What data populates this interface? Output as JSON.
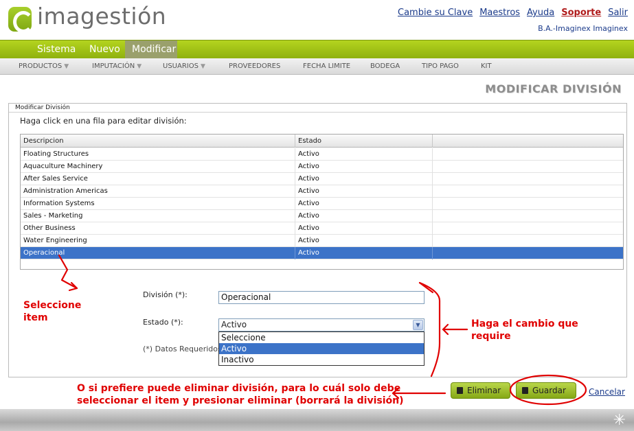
{
  "header": {
    "logo_text": "imagestión",
    "links": [
      "Cambie su Clave",
      "Maestros",
      "Ayuda",
      "Soporte",
      "Salir"
    ],
    "company": "B.A.-Imaginex Imaginex"
  },
  "main_menu": {
    "items": [
      "Sistema",
      "Nuevo",
      "Modificar"
    ],
    "active": "Modificar"
  },
  "sub_menu": {
    "items": [
      {
        "label": "PRODUCTOS",
        "arrow": "▼"
      },
      {
        "label": "IMPUTACIÓN",
        "arrow": "▼"
      },
      {
        "label": "USUARIOS",
        "arrow": "▼"
      },
      {
        "label": "PROVEEDORES",
        "arrow": ""
      },
      {
        "label": "FECHA LIMITE",
        "arrow": ""
      },
      {
        "label": "BODEGA",
        "arrow": ""
      },
      {
        "label": "TIPO PAGO",
        "arrow": ""
      },
      {
        "label": "KIT",
        "arrow": ""
      }
    ]
  },
  "page_title": "MODIFICAR DIVISIÓN",
  "panel": {
    "title": "Modificar División",
    "instruction": "Haga click en una fila para editar división:",
    "columns": [
      "Descripcion",
      "Estado"
    ],
    "rows": [
      {
        "descripcion": "Floating Structures",
        "estado": "Activo"
      },
      {
        "descripcion": "Aquaculture Machinery",
        "estado": "Activo"
      },
      {
        "descripcion": "After Sales Service",
        "estado": "Activo"
      },
      {
        "descripcion": "Administration Americas",
        "estado": "Activo"
      },
      {
        "descripcion": "Information Systems",
        "estado": "Activo"
      },
      {
        "descripcion": "Sales - Marketing",
        "estado": "Activo"
      },
      {
        "descripcion": "Other Business",
        "estado": "Activo"
      },
      {
        "descripcion": "Water Engineering",
        "estado": "Activo"
      },
      {
        "descripcion": "Operacional",
        "estado": "Activo"
      }
    ],
    "selected_row": 8
  },
  "form": {
    "division_label": "División (*):",
    "division_value": "Operacional",
    "estado_label": "Estado (*):",
    "estado_value": "Activo",
    "estado_options": [
      "Seleccione",
      "Activo",
      "Inactivo"
    ],
    "estado_selected_option": "Activo",
    "required_note": "(*) Datos Requeridos"
  },
  "buttons": {
    "delete": "Eliminar",
    "save": "Guardar",
    "cancel": "Cancelar"
  },
  "annotations": {
    "select_item": "Seleccione item",
    "make_change": "Haga el cambio que require",
    "delete_note_1": "O si prefiere puede eliminar división, para lo cuál solo debe",
    "delete_note_2": "seleccionar el item y presionar eliminar (borrará la división)"
  },
  "colors": {
    "brand_green": "#9cbf15",
    "selection_blue": "#3c73c8",
    "annotation_red": "#e00000"
  }
}
